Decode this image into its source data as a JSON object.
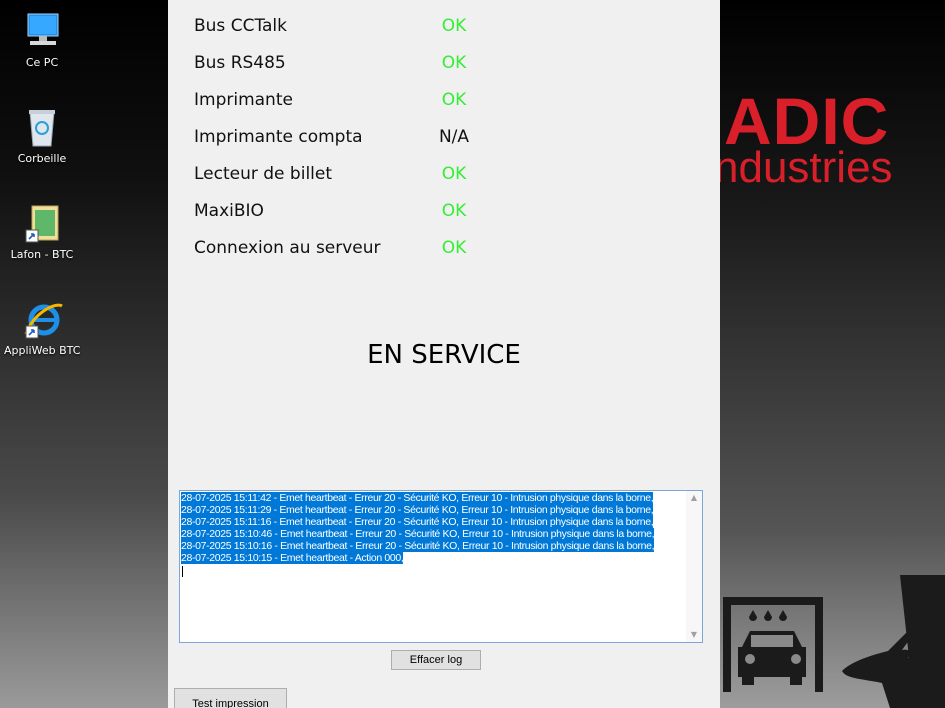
{
  "desktop": {
    "icons": [
      {
        "label": "Ce PC",
        "icon": "computer-icon"
      },
      {
        "label": "Corbeille",
        "icon": "recycle-bin-icon"
      },
      {
        "label": "Lafon - BTC",
        "icon": "folder-shortcut-icon"
      },
      {
        "label": "AppliWeb BTC",
        "icon": "internet-explorer-icon"
      }
    ],
    "brand": {
      "line1": "ADIC",
      "line2": "ndustries"
    }
  },
  "status": [
    {
      "name": "Bus CCTalk",
      "value": "OK"
    },
    {
      "name": "Bus RS485",
      "value": "OK"
    },
    {
      "name": "Imprimante",
      "value": "OK"
    },
    {
      "name": "Imprimante compta",
      "value": "N/A"
    },
    {
      "name": "Lecteur de billet",
      "value": "OK"
    },
    {
      "name": "MaxiBIO",
      "value": "OK"
    },
    {
      "name": "Connexion au serveur",
      "value": "OK"
    }
  ],
  "service_state": "EN SERVICE",
  "log": {
    "lines": [
      "28-07-2025 15:11:42 - Emet heartbeat - Erreur 20 - Sécurité KO, Erreur 10 - Intrusion physique dans la borne,",
      "28-07-2025 15:11:29 - Emet heartbeat - Erreur 20 - Sécurité KO, Erreur 10 - Intrusion physique dans la borne,",
      "28-07-2025 15:11:16 - Emet heartbeat - Erreur 20 - Sécurité KO, Erreur 10 - Intrusion physique dans la borne,",
      "28-07-2025 15:10:46 - Emet heartbeat - Erreur 20 - Sécurité KO, Erreur 10 - Intrusion physique dans la borne,",
      "28-07-2025 15:10:16 - Emet heartbeat - Erreur 20 - Sécurité KO, Erreur 10 - Intrusion physique dans la borne,",
      "28-07-2025 15:10:15 - Emet heartbeat - Action 000,"
    ]
  },
  "buttons": {
    "clear_log": "Effacer log",
    "test_print": "Test impression"
  },
  "colors": {
    "ok": "#33ee33",
    "selection": "#0078d7",
    "brand": "#d9202a"
  }
}
